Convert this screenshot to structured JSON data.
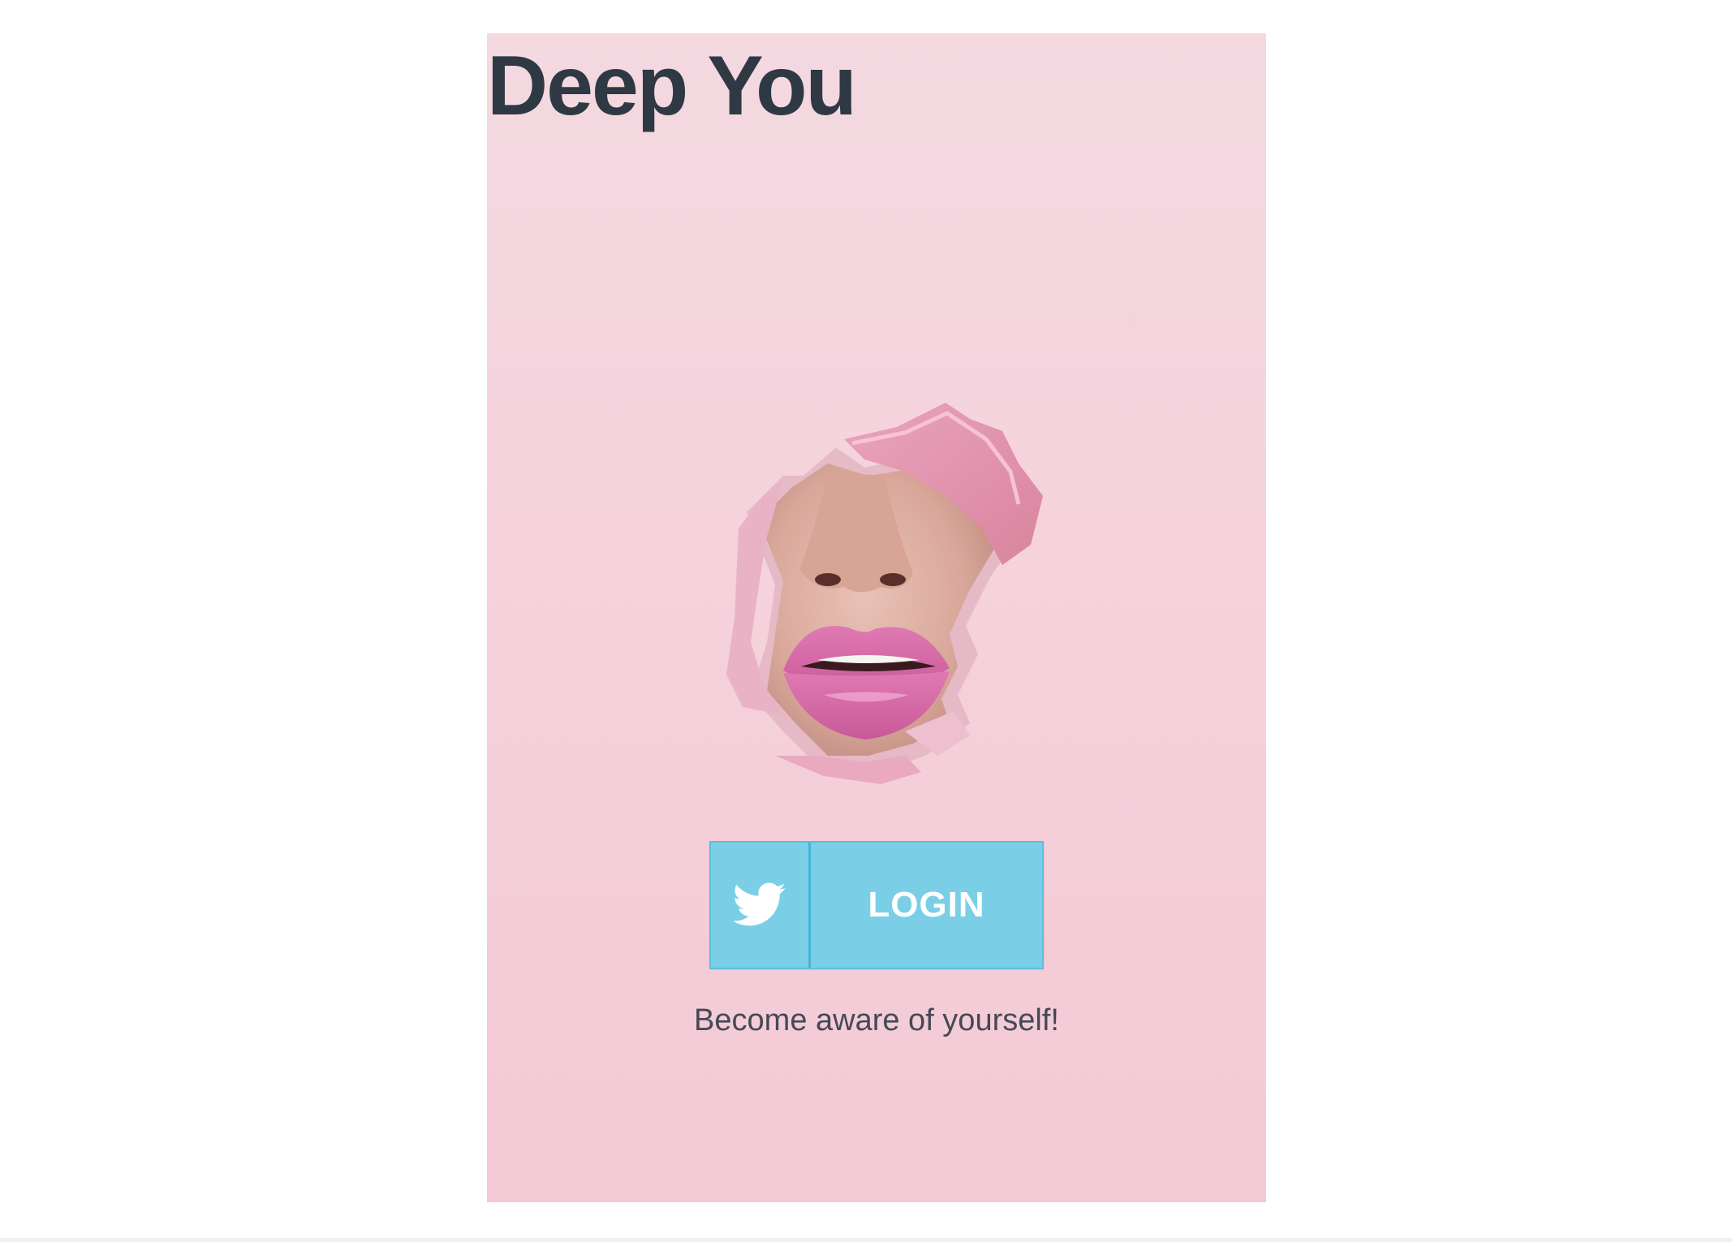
{
  "app": {
    "title": "Deep You"
  },
  "hero": {
    "image_icon": "torn-paper-lips-illustration"
  },
  "login": {
    "icon": "twitter-bird-icon",
    "label": "LOGIN"
  },
  "tagline": "Become aware of yourself!",
  "colors": {
    "card_background": "#f4d3dd",
    "title": "#2e3944",
    "button_background": "#7acfe6",
    "button_divider": "#49b4d6",
    "tagline": "#444a55"
  }
}
